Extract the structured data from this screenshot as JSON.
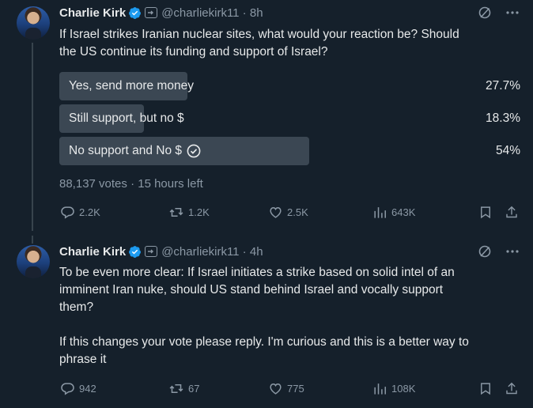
{
  "tweets": [
    {
      "author": "Charlie Kirk",
      "handle": "@charliekirk11 · 8h",
      "text_lines": [
        "If Israel strikes Iranian nuclear sites, what would your reaction be? Should",
        "the US continue its funding and support of Israel?"
      ],
      "poll": {
        "options": [
          {
            "label": "Yes, send more money",
            "percent_text": "27.7%",
            "percent": 27.7
          },
          {
            "label": "Still support, but no $",
            "percent_text": "18.3%",
            "percent": 18.3
          },
          {
            "label": "No support and No $",
            "percent_text": "54%",
            "percent": 54,
            "selected": true
          }
        ],
        "meta": "88,137 votes · 15 hours left"
      },
      "stats": {
        "replies": "2.2K",
        "reposts": "1.2K",
        "likes": "2.5K",
        "views": "643K"
      }
    },
    {
      "author": "Charlie Kirk",
      "handle": "@charliekirk11 · 4h",
      "text_lines": [
        "To be even more clear: If Israel initiates a strike based on solid intel of an",
        "imminent Iran nuke, should US stand behind Israel and vocally support",
        "them?",
        "",
        "If this changes your vote please reply. I'm curious and this is a better way to",
        "phrase it"
      ],
      "stats": {
        "replies": "942",
        "reposts": "67",
        "likes": "775",
        "views": "108K"
      }
    }
  ],
  "colors": {
    "background": "#15202b",
    "text": "#e7e9ea",
    "muted": "#8b98a5",
    "poll_fill": "#3b4753",
    "verified": "#1d9bf0"
  },
  "icons": [
    "verified-badge-icon",
    "affiliate-badge-icon",
    "grok-icon",
    "more-icon",
    "reply-icon",
    "repost-icon",
    "like-icon",
    "views-icon",
    "bookmark-icon",
    "share-icon",
    "check-circle-icon"
  ]
}
